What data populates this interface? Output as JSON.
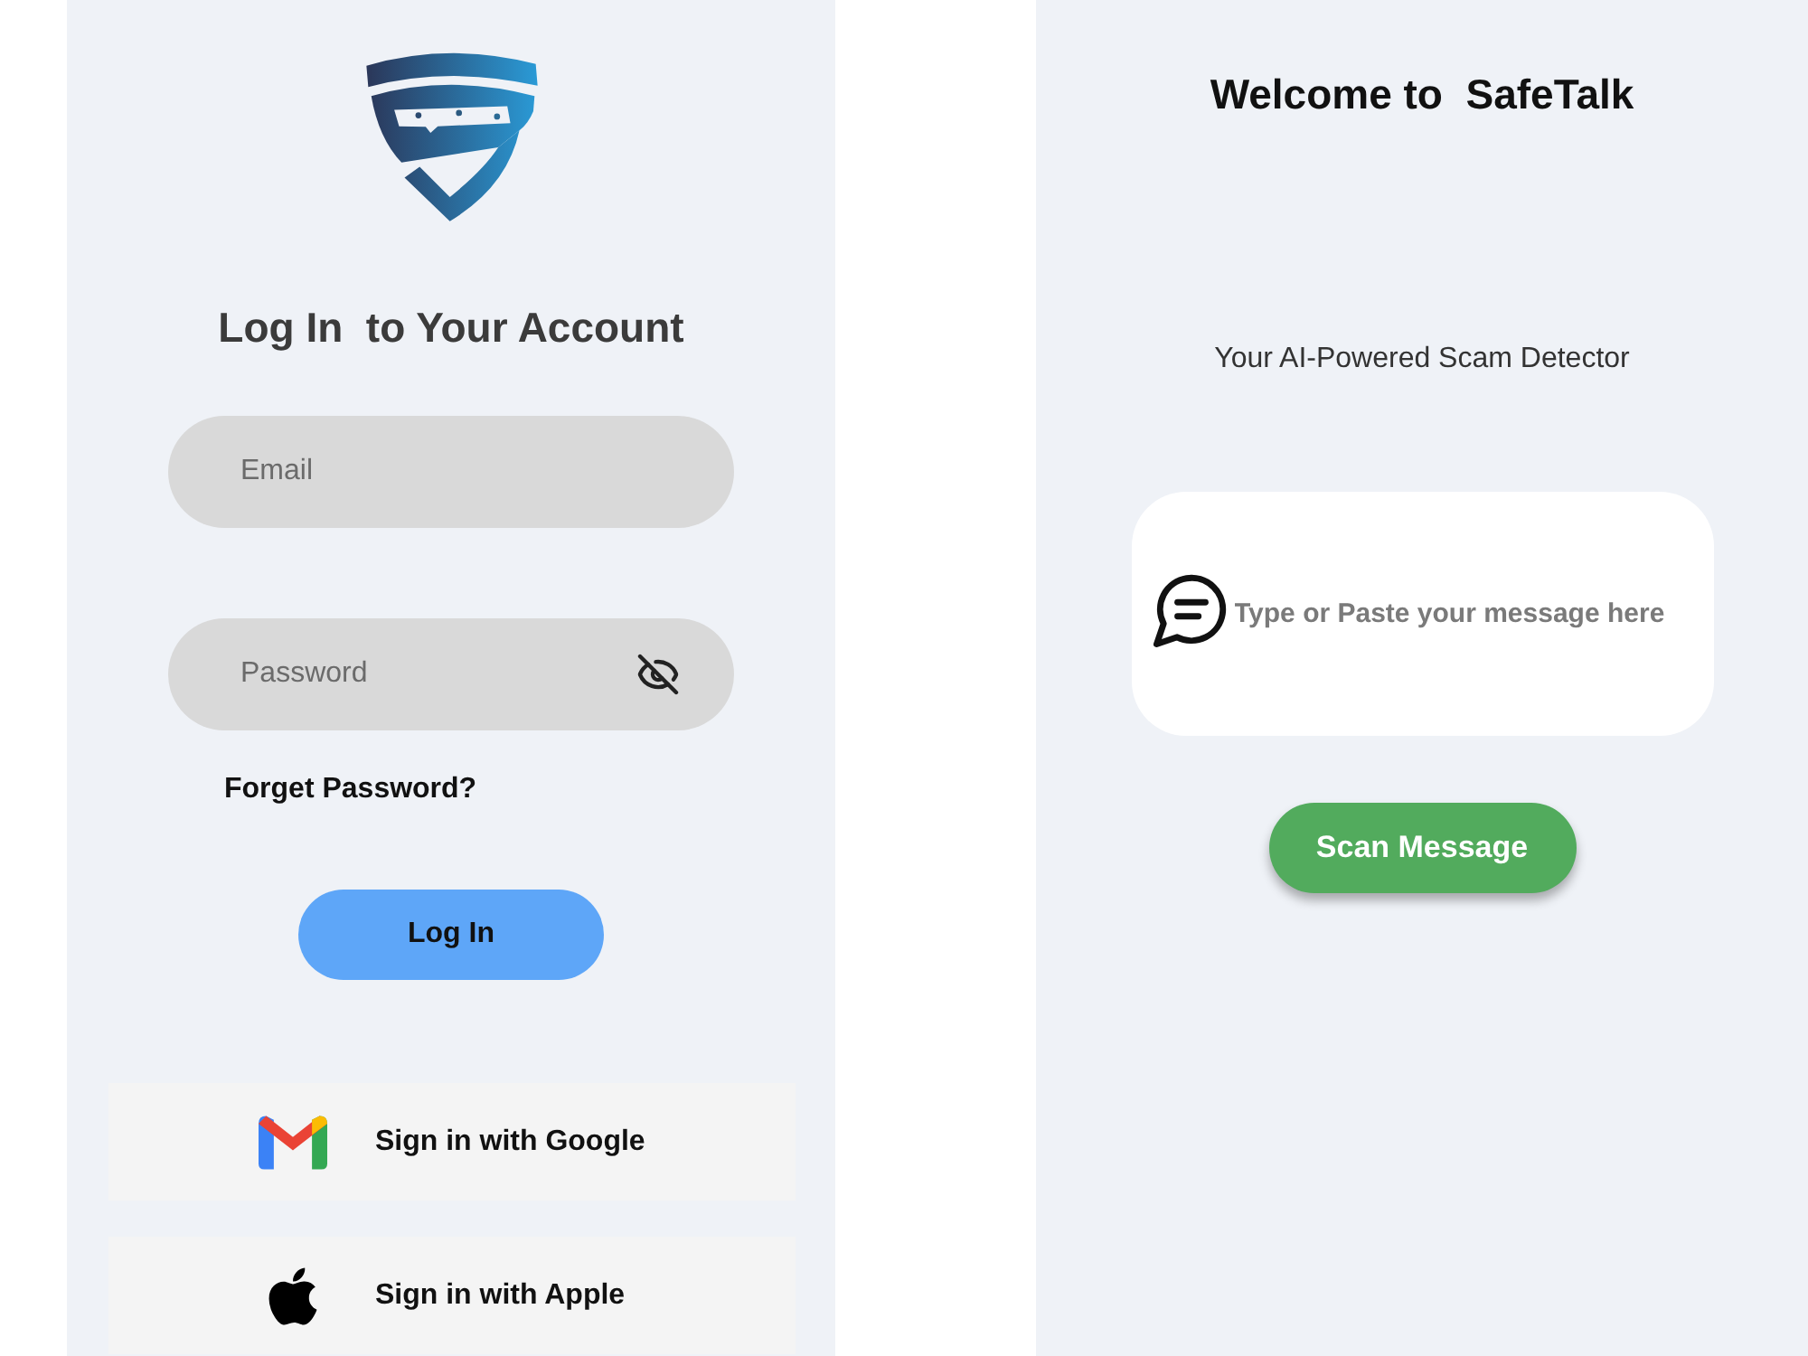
{
  "login": {
    "title": "Log In  to Your Account",
    "fields": [
      {
        "kind": "email",
        "placeholder": "Email"
      },
      {
        "kind": "password",
        "placeholder": "Password",
        "revealed": false
      }
    ],
    "forgot_link": "Forget Password?",
    "submit": "Log In",
    "social": [
      {
        "kind": "google",
        "label": "Sign in with Google"
      },
      {
        "kind": "apple",
        "label": "Sign in with Apple"
      }
    ]
  },
  "scanner": {
    "title": "Welcome to  SafeTalk",
    "subtitle": "Your AI-Powered Scam Detector",
    "message": {
      "placeholder": "Type or Paste your message here"
    },
    "button": "Scan Message"
  }
}
